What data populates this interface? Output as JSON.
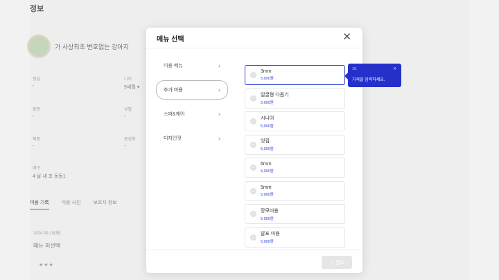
{
  "background": {
    "title": "정보",
    "pet_name": "가 사상최초 변호없는 강아지",
    "fields": [
      {
        "label": "생일",
        "value": "-",
        "label2": "나이",
        "value2": "5세월 ▾"
      },
      {
        "label": "품종",
        "value": "-",
        "label2": "성별",
        "value2": "-"
      },
      {
        "label": "체중",
        "value": "-",
        "label2": "중성화",
        "value2": "-"
      },
      {
        "label": "메모",
        "value": "4 날 새 초 동동1",
        "label2": "",
        "value2": ""
      }
    ],
    "tabs": [
      "미용 기록",
      "미용 사진",
      "보호자 정보"
    ],
    "record_date": "2024.09.10(화)",
    "record_menu": "메뉴 미선택",
    "stars": "★★★"
  },
  "modal": {
    "title": "메뉴 선택",
    "close_label": "✕",
    "categories": [
      {
        "label": "미용 메뉴"
      },
      {
        "label": "추가 미용"
      },
      {
        "label": "스파&케어"
      },
      {
        "label": "디자인컷"
      }
    ],
    "options": [
      {
        "name": "3mm",
        "price": "5,000원"
      },
      {
        "name": "얼굴형 다듬기",
        "price": "5,000원"
      },
      {
        "name": "시니어",
        "price": "5,000원"
      },
      {
        "name": "엉킴",
        "price": "5,000원"
      },
      {
        "name": "6mm",
        "price": "5,000원"
      },
      {
        "name": "5mm",
        "price": "5,000원"
      },
      {
        "name": "장모미용",
        "price": "5,000원"
      },
      {
        "name": "발포 미용",
        "price": "5,000원"
      }
    ],
    "confirm_label": "완료"
  },
  "tooltip": {
    "small": "1/1",
    "close": "✕",
    "text": "가격을 입력하세요."
  },
  "colors": {
    "accent": "#2430c9",
    "selected_border": "#2b3fcf"
  }
}
